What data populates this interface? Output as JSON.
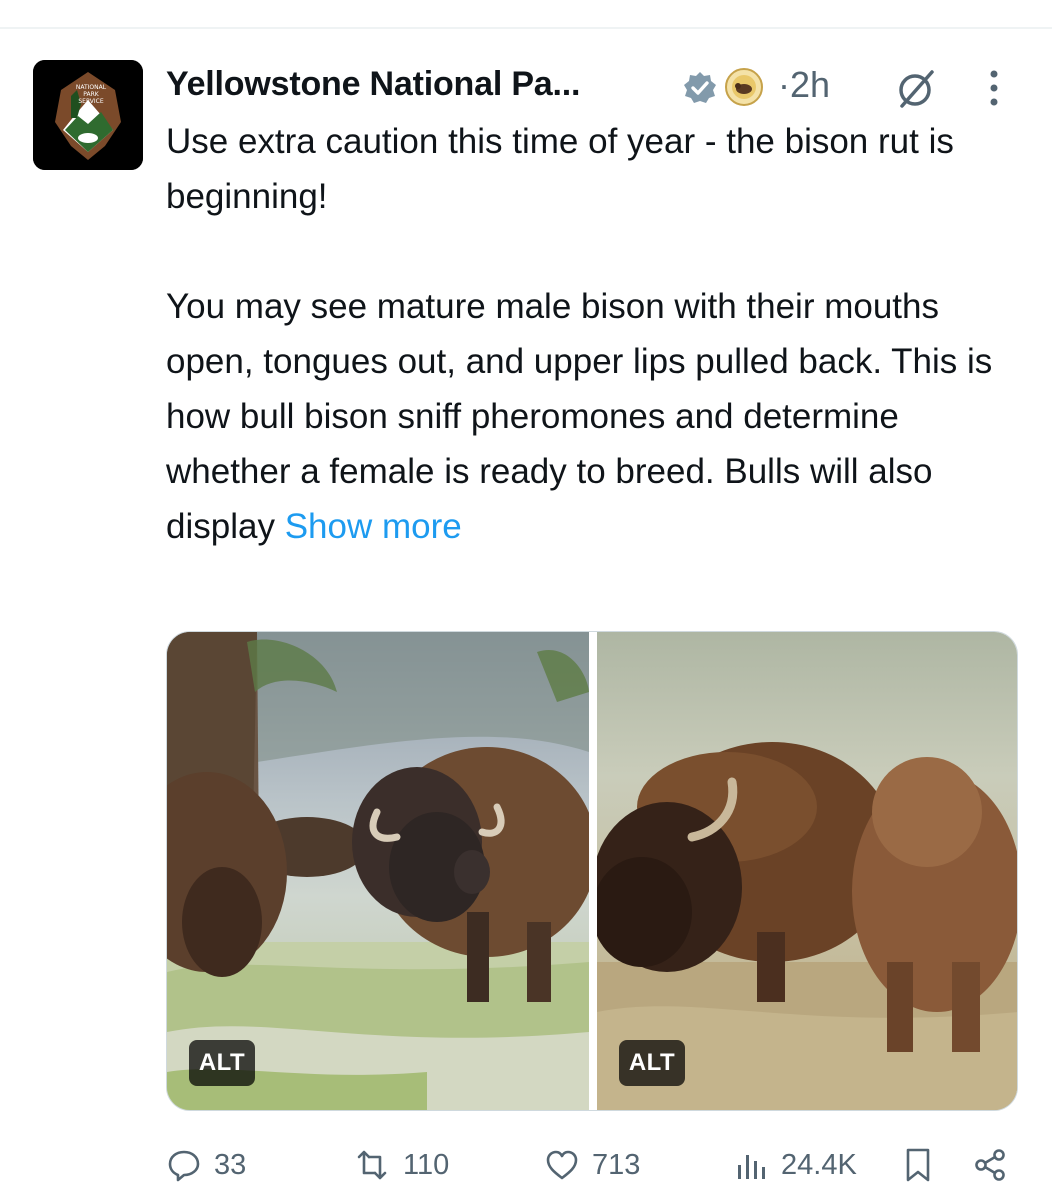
{
  "post": {
    "author_name": "Yellowstone National Pa...",
    "time": "2h",
    "text_line_1": "Use extra caution this time of year - the bison rut is beginning!",
    "text_line_2": "You may see mature male bison with their mouths open, tongues out, and upper lips pulled back. This is how bull bison sniff pheromones and determine whether a female is ready to breed. Bulls will also display",
    "show_more": "Show more"
  },
  "avatar": {
    "logo_text_1": "NATIONAL",
    "logo_text_2": "PARK",
    "logo_text_3": "SERVICE"
  },
  "media": {
    "left_alt_label": "ALT",
    "right_alt_label": "ALT"
  },
  "actions": {
    "replies": "33",
    "reposts": "110",
    "likes": "713",
    "views": "24.4K"
  },
  "colors": {
    "accent": "#1d9bf0",
    "muted": "#536471",
    "verified": "#829aab"
  }
}
